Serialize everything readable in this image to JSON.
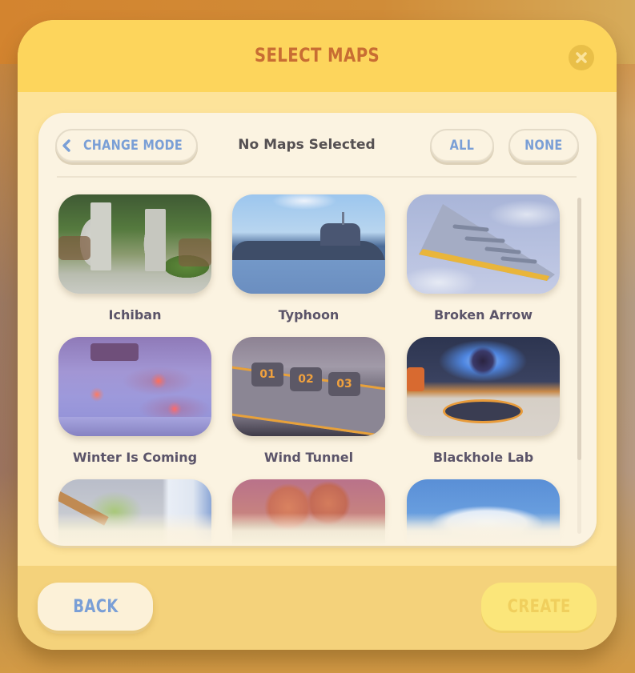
{
  "dialog": {
    "title": "SELECT MAPS",
    "close_icon": "close-x-icon"
  },
  "toolbar": {
    "change_mode_label": "CHANGE MODE",
    "change_mode_icon": "chevron-left-icon",
    "status": "No Maps Selected",
    "all_label": "ALL",
    "none_label": "NONE"
  },
  "maps": [
    {
      "name": "Ichiban",
      "theme": "jungle-ruins"
    },
    {
      "name": "Typhoon",
      "theme": "submarine-ocean"
    },
    {
      "name": "Broken Arrow",
      "theme": "flying-wing-sky"
    },
    {
      "name": "Winter Is Coming",
      "theme": "snow-village"
    },
    {
      "name": "Wind Tunnel",
      "theme": "race-track"
    },
    {
      "name": "Blackhole Lab",
      "theme": "sci-fi-lab"
    },
    {
      "name": "",
      "theme": "waterfall-cliffs"
    },
    {
      "name": "",
      "theme": "canyon-rocks"
    },
    {
      "name": "",
      "theme": "ice-floes"
    }
  ],
  "scroll": {
    "visible_fraction": 0.78,
    "position": 0.0
  },
  "footer": {
    "back_label": "BACK",
    "create_label": "CREATE",
    "create_enabled": false
  },
  "colors": {
    "header": "#fdd55c",
    "title": "#c86d33",
    "accent_blue": "#7a9fd6",
    "panel": "#fbf3e1",
    "map_label": "#5b5469"
  }
}
